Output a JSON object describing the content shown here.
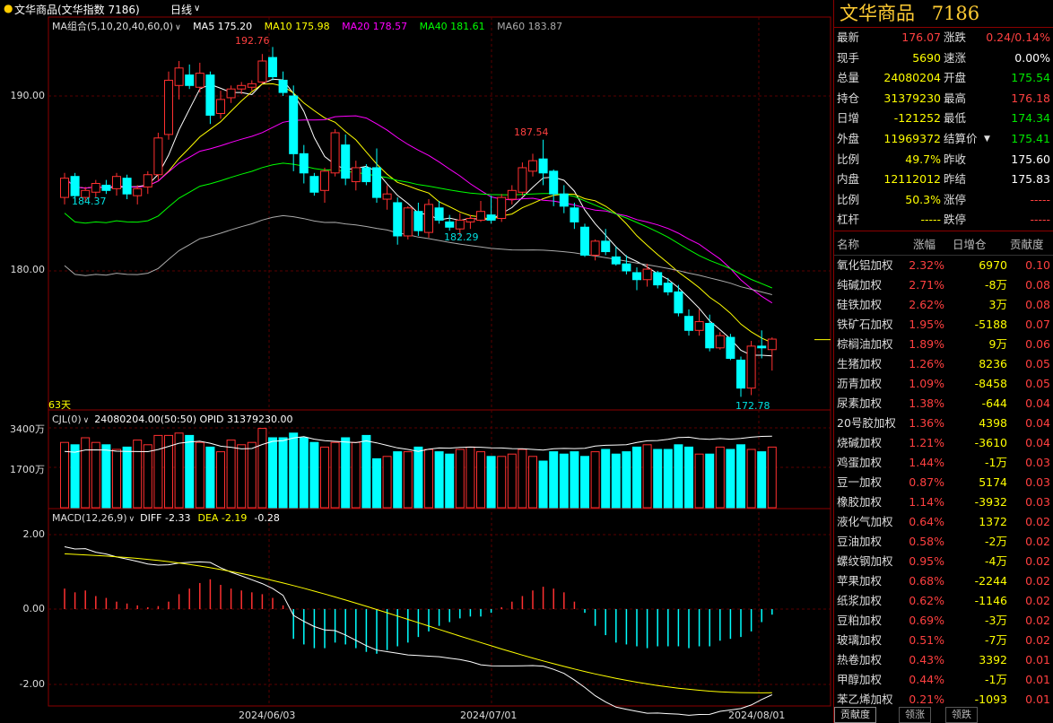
{
  "title_bar": {
    "instrument": "文华商品(文华指数  7186)",
    "period": "日线"
  },
  "ma_legend": {
    "label": "MA组合(5,10,20,40,60,0)",
    "items": [
      {
        "label": "MA5 175.20",
        "color": "#ffffff"
      },
      {
        "label": "MA10 175.98",
        "color": "#ffff00"
      },
      {
        "label": "MA20 178.57",
        "color": "#ff00ff"
      },
      {
        "label": "MA40 181.61",
        "color": "#00ff00"
      },
      {
        "label": "MA60 183.87",
        "color": "#aaaaaa"
      }
    ]
  },
  "price_axis": {
    "ticks": [
      "190.00",
      "180.00"
    ]
  },
  "annotations": {
    "high1": "192.76",
    "high2": "187.54",
    "low1": "184.37",
    "low2": "182.29",
    "low3": "172.78",
    "days": "63天"
  },
  "volume_panel": {
    "label": "CJL(0)",
    "values": "24080204.00(50:50)  OPID 31379230.00",
    "ticks": [
      "3400万",
      "1700万"
    ]
  },
  "macd_panel": {
    "label": "MACD(12,26,9)",
    "diff": "DIFF -2.33",
    "dea": "DEA -2.19",
    "macd": "-0.28",
    "ticks": [
      "2.00",
      "0.00",
      "-2.00"
    ]
  },
  "x_axis": {
    "labels": [
      "2024/06/03",
      "2024/07/01",
      "2024/08/01"
    ]
  },
  "chart_data": {
    "type": "candlestick",
    "candles": [
      [
        184.2,
        185.6,
        183.8,
        185.3
      ],
      [
        185.4,
        185.6,
        183.9,
        184.3
      ],
      [
        184.2,
        184.8,
        183.9,
        184.6
      ],
      [
        184.5,
        185.2,
        184.2,
        185.0
      ],
      [
        184.9,
        185.2,
        184.4,
        184.6
      ],
      [
        184.7,
        185.6,
        184.3,
        185.4
      ],
      [
        185.3,
        185.5,
        184.1,
        184.4
      ],
      [
        184.3,
        184.9,
        183.8,
        184.7
      ],
      [
        184.8,
        185.7,
        184.4,
        185.5
      ],
      [
        185.5,
        187.9,
        185.2,
        187.6
      ],
      [
        187.8,
        191.4,
        187.5,
        190.9
      ],
      [
        190.6,
        192.0,
        189.8,
        191.6
      ],
      [
        191.2,
        191.8,
        190.4,
        190.6
      ],
      [
        190.5,
        191.9,
        190.2,
        191.3
      ],
      [
        191.2,
        191.4,
        188.4,
        188.9
      ],
      [
        189.0,
        190.3,
        188.7,
        189.8
      ],
      [
        189.9,
        190.6,
        189.6,
        190.4
      ],
      [
        190.4,
        190.8,
        190.1,
        190.6
      ],
      [
        190.5,
        190.9,
        190.3,
        190.7
      ],
      [
        190.8,
        192.4,
        190.7,
        192.0
      ],
      [
        192.2,
        192.8,
        190.9,
        191.1
      ],
      [
        190.9,
        191.4,
        190.0,
        190.2
      ],
      [
        190.0,
        190.6,
        185.7,
        186.7
      ],
      [
        186.7,
        187.2,
        185.0,
        185.6
      ],
      [
        185.4,
        185.6,
        184.3,
        184.5
      ],
      [
        184.6,
        185.9,
        183.9,
        185.7
      ],
      [
        185.6,
        188.1,
        185.4,
        187.9
      ],
      [
        187.2,
        187.8,
        184.9,
        185.3
      ],
      [
        185.1,
        186.3,
        184.6,
        185.9
      ],
      [
        185.9,
        186.1,
        184.9,
        185.1
      ],
      [
        185.9,
        187.0,
        183.9,
        184.2
      ],
      [
        184.1,
        184.9,
        183.5,
        184.4
      ],
      [
        183.9,
        184.2,
        181.5,
        182.0
      ],
      [
        182.0,
        183.7,
        181.8,
        183.6
      ],
      [
        183.4,
        183.9,
        182.0,
        182.3
      ],
      [
        182.2,
        184.1,
        181.9,
        183.8
      ],
      [
        183.6,
        184.0,
        182.7,
        182.9
      ],
      [
        182.8,
        183.2,
        182.3,
        182.5
      ],
      [
        182.4,
        183.3,
        182.0,
        182.9
      ],
      [
        182.8,
        183.2,
        182.4,
        183.0
      ],
      [
        182.9,
        184.0,
        182.8,
        183.4
      ],
      [
        183.2,
        184.3,
        182.7,
        182.9
      ],
      [
        183.0,
        184.4,
        182.8,
        184.2
      ],
      [
        184.1,
        184.9,
        183.8,
        184.6
      ],
      [
        184.5,
        186.2,
        184.3,
        185.9
      ],
      [
        185.7,
        186.7,
        185.4,
        186.3
      ],
      [
        186.4,
        187.5,
        184.9,
        185.6
      ],
      [
        185.7,
        185.8,
        183.7,
        184.4
      ],
      [
        184.4,
        184.9,
        183.3,
        183.7
      ],
      [
        183.6,
        183.9,
        182.4,
        182.8
      ],
      [
        182.5,
        182.7,
        180.8,
        180.9
      ],
      [
        180.9,
        181.8,
        180.6,
        181.7
      ],
      [
        181.7,
        182.4,
        180.9,
        181.1
      ],
      [
        180.8,
        181.4,
        180.3,
        180.4
      ],
      [
        180.4,
        180.9,
        179.8,
        180.0
      ],
      [
        179.9,
        180.2,
        178.9,
        179.5
      ],
      [
        179.5,
        180.4,
        179.1,
        180.1
      ],
      [
        179.9,
        180.0,
        179.0,
        179.2
      ],
      [
        179.3,
        179.6,
        178.6,
        178.8
      ],
      [
        178.8,
        179.2,
        177.4,
        177.6
      ],
      [
        177.4,
        177.8,
        176.3,
        176.6
      ],
      [
        176.6,
        177.8,
        176.3,
        177.1
      ],
      [
        177.0,
        177.5,
        175.4,
        175.6
      ],
      [
        175.6,
        176.5,
        175.5,
        176.3
      ],
      [
        176.2,
        176.4,
        174.9,
        175.0
      ],
      [
        174.9,
        175.1,
        172.8,
        173.3
      ],
      [
        173.3,
        176.0,
        172.9,
        175.7
      ],
      [
        175.7,
        176.6,
        175.0,
        175.6
      ],
      [
        175.5,
        176.2,
        174.3,
        176.1
      ]
    ],
    "volume": [
      28,
      27,
      30,
      28,
      27,
      25,
      26,
      29,
      27,
      31,
      31,
      32,
      31,
      28,
      26,
      24,
      29,
      27,
      28,
      34,
      30,
      30,
      32,
      30,
      28,
      26,
      28,
      30,
      28,
      31,
      21,
      22,
      24,
      24,
      26,
      25,
      24,
      23,
      25,
      26,
      24,
      22,
      22,
      23,
      25,
      22,
      20,
      24,
      23,
      24,
      22,
      24,
      25,
      23,
      24,
      26,
      27,
      25,
      25,
      27,
      26,
      23,
      23,
      26,
      25,
      27,
      25,
      24,
      26
    ],
    "macd_hist": [
      0.55,
      0.45,
      0.5,
      0.35,
      0.3,
      0.2,
      0.15,
      0.1,
      0.05,
      0.08,
      0.2,
      0.4,
      0.55,
      0.7,
      0.8,
      0.65,
      0.55,
      0.5,
      0.45,
      0.4,
      0.3,
      0.1,
      -0.8,
      -0.95,
      -1.05,
      -1.05,
      -0.9,
      -0.95,
      -1.05,
      -1.15,
      -1.2,
      -1.1,
      -1.0,
      -0.9,
      -0.75,
      -0.6,
      -0.45,
      -0.35,
      -0.25,
      -0.2,
      -0.2,
      -0.1,
      0.05,
      0.2,
      0.35,
      0.5,
      0.6,
      0.55,
      0.45,
      0.2,
      -0.1,
      -0.45,
      -0.7,
      -0.9,
      -0.95,
      -1.0,
      -1.05,
      -1.0,
      -1.0,
      -1.0,
      -1.05,
      -1.0,
      -1.0,
      -0.85,
      -0.8,
      -0.75,
      -0.6,
      -0.35,
      -0.15
    ]
  },
  "quote": {
    "name": "文华商品",
    "code": "7186",
    "rows": [
      {
        "l1": "最新",
        "v1": "176.07",
        "c1": "red",
        "l2": "涨跌",
        "v2": "0.24/0.14%",
        "c2": "red"
      },
      {
        "l1": "现手",
        "v1": "5690",
        "c1": "yellow",
        "l2": "速涨",
        "v2": "0.00%",
        "c2": "white"
      },
      {
        "l1": "总量",
        "v1": "24080204",
        "c1": "yellow",
        "l2": "开盘",
        "v2": "175.54",
        "c2": "green"
      },
      {
        "l1": "持仓",
        "v1": "31379230",
        "c1": "yellow",
        "l2": "最高",
        "v2": "176.18",
        "c2": "red"
      },
      {
        "l1": "日增",
        "v1": "-121252",
        "c1": "yellow",
        "l2": "最低",
        "v2": "174.34",
        "c2": "green"
      },
      {
        "l1": "外盘",
        "v1": "11969372",
        "c1": "yellow",
        "l2": "结算价",
        "v2": "175.41",
        "c2": "green"
      },
      {
        "l1": "比例",
        "v1": "49.7%",
        "c1": "yellow",
        "l2": "昨收",
        "v2": "175.60",
        "c2": "white"
      },
      {
        "l1": "内盘",
        "v1": "12112012",
        "c1": "yellow",
        "l2": "昨结",
        "v2": "175.83",
        "c2": "white"
      },
      {
        "l1": "比例",
        "v1": "50.3%",
        "c1": "yellow",
        "l2": "涨停",
        "v2": "-----",
        "c2": "red"
      },
      {
        "l1": "杠杆",
        "v1": "-----",
        "c1": "yellow",
        "l2": "跌停",
        "v2": "-----",
        "c2": "red"
      }
    ]
  },
  "contrib": {
    "headers": [
      "名称",
      "涨幅",
      "日增仓",
      "贡献度"
    ],
    "rows": [
      [
        "氧化铝加权",
        "2.32%",
        "6970",
        "0.10"
      ],
      [
        "纯碱加权",
        "2.71%",
        "-8万",
        "0.08"
      ],
      [
        "硅铁加权",
        "2.62%",
        "3万",
        "0.08"
      ],
      [
        "铁矿石加权",
        "1.95%",
        "-5188",
        "0.07"
      ],
      [
        "棕榈油加权",
        "1.89%",
        "9万",
        "0.06"
      ],
      [
        "生猪加权",
        "1.26%",
        "8236",
        "0.05"
      ],
      [
        "沥青加权",
        "1.09%",
        "-8458",
        "0.05"
      ],
      [
        "尿素加权",
        "1.38%",
        "-644",
        "0.04"
      ],
      [
        "20号胶加权",
        "1.36%",
        "4398",
        "0.04"
      ],
      [
        "烧碱加权",
        "1.21%",
        "-3610",
        "0.04"
      ],
      [
        "鸡蛋加权",
        "1.44%",
        "-1万",
        "0.03"
      ],
      [
        "豆一加权",
        "0.87%",
        "5174",
        "0.03"
      ],
      [
        "橡胶加权",
        "1.14%",
        "-3932",
        "0.03"
      ],
      [
        "液化气加权",
        "0.64%",
        "1372",
        "0.02"
      ],
      [
        "豆油加权",
        "0.58%",
        "-2万",
        "0.02"
      ],
      [
        "螺纹钢加权",
        "0.95%",
        "-4万",
        "0.02"
      ],
      [
        "苹果加权",
        "0.68%",
        "-2244",
        "0.02"
      ],
      [
        "纸浆加权",
        "0.62%",
        "-1146",
        "0.02"
      ],
      [
        "豆粕加权",
        "0.69%",
        "-3万",
        "0.02"
      ],
      [
        "玻璃加权",
        "0.51%",
        "-7万",
        "0.02"
      ],
      [
        "热卷加权",
        "0.43%",
        "3392",
        "0.01"
      ],
      [
        "甲醇加权",
        "0.44%",
        "-1万",
        "0.01"
      ],
      [
        "苯乙烯加权",
        "0.21%",
        "-1093",
        "0.01"
      ]
    ]
  },
  "tabs": [
    "贡献度",
    "领涨",
    "领跌"
  ]
}
